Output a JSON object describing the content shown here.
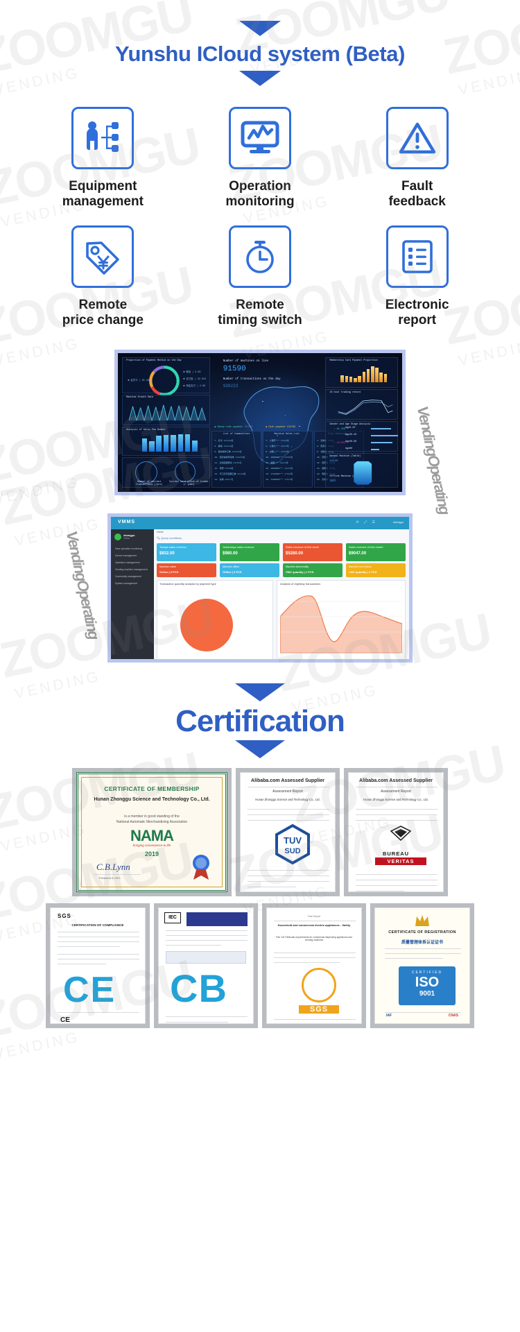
{
  "watermarks": {
    "brand": "ZOOMGU",
    "sub": "VENDING",
    "script": "VendingOperating"
  },
  "hero": {
    "title": "Yunshu ICloud system (Beta)",
    "arrow_color": "#2f5fc4"
  },
  "features": [
    {
      "label_line1": "Equipment",
      "label_line2": "management",
      "icon": "org-chart-person-icon"
    },
    {
      "label_line1": "Operation",
      "label_line2": "monitoring",
      "icon": "monitor-chart-icon"
    },
    {
      "label_line1": "Fault",
      "label_line2": "feedback",
      "icon": "warning-triangle-icon"
    },
    {
      "label_line1": "Remote",
      "label_line2": "price change",
      "icon": "price-tag-yuan-icon"
    },
    {
      "label_line1": "Remote",
      "label_line2": "timing switch",
      "icon": "stopwatch-icon"
    },
    {
      "label_line1": "Electronic",
      "label_line2": "report",
      "icon": "report-list-icon"
    }
  ],
  "dark_dashboard": {
    "panels": {
      "payment_proportion_title": "Proportion of Payment Method on the Day",
      "machines_online_label": "Number of machines on line",
      "machines_online_value": "91590",
      "transactions_label": "Number of transactions on the day",
      "transactions_value": "930223",
      "membership_card_title": "Membership Card Payment Proportion",
      "trading_record_title": "24 hour trading record",
      "machine_growth_title": "Machine Growth Data",
      "sales_pen_title": "Analysis of Sales Pen Number",
      "gender_age_title": "Gender and Age Stage Analysis",
      "commodities_title": "List of Commodities",
      "machine_sales_title": "Machine Sales List",
      "city_rankings_title": "City Rankings",
      "normal_machine_title": "Normal Machine (Table)",
      "offline_machine_title": "Offline Machine (Station)",
      "sweep_code_payment": "Sweep code payment",
      "sweep_code_value": "791333",
      "cash_payment": "Cash payment",
      "cash_value": "132789",
      "gauge_left_label": "Number of current transactions (/pcs)",
      "gauge_right_label": "Current unit price of trader (/ yuan)",
      "normal_value": "61530",
      "offline_value": "4927",
      "age_rows": [
        {
          "label": "Age0-20",
          "pct": "22%"
        },
        {
          "label": "Age20-40",
          "pct": "41%"
        },
        {
          "label": "Age40-60",
          "pct": "24%"
        },
        {
          "label": "Age60",
          "pct": "13%"
        }
      ],
      "gender": [
        {
          "label": "81.25%",
          "color": "#2fd6d0"
        },
        {
          "label": "18.65%",
          "color": "#e8407a"
        }
      ]
    }
  },
  "light_dashboard": {
    "app_name": "VMMS",
    "user": "zhongyu",
    "user_status": "Online",
    "breadcrumb": "Home",
    "query_label": "Query conditions",
    "top_right_user": "zhongyu",
    "sidebar": [
      "Data operation monitoring",
      "Device management",
      "Operation management",
      "Vending machine management",
      "Commodity management",
      "System management"
    ],
    "stat_cards": [
      {
        "title": "Todays sales revenue",
        "value": "$832.00",
        "color": "#3db7e4"
      },
      {
        "title": "Yesterdays sales revenue",
        "value": "$980.00",
        "color": "#31a648"
      },
      {
        "title": "Sales revenue of this week",
        "value": "$5280.00",
        "color": "#ea5532"
      },
      {
        "title": "Sales revenue of this month",
        "value": "$9047.00",
        "color": "#31a648"
      }
    ],
    "status_cards": [
      {
        "title": "Machine online",
        "value": "Online | 3 PCS",
        "color": "#ea5532"
      },
      {
        "title": "Machine offline",
        "value": "Offline | 0 PCS",
        "color": "#3db7e4"
      },
      {
        "title": "Machine abnormality",
        "value": "VMC quantity | 1 PCS",
        "color": "#31a648"
      },
      {
        "title": "Machine out of stock",
        "value": "VMC quantity | 1 PCS",
        "color": "#f2b21a"
      }
    ],
    "chart_left_title": "Transaction quantity analysis by payment type",
    "chart_right_title": "Analysis of eightday transactions"
  },
  "certification": {
    "title": "Certification"
  },
  "certificates_row1": [
    {
      "name": "nama-membership",
      "title": "CERTIFICATE OF MEMBERSHIP",
      "company": "Hunan Zhonggu Science and Technology Co., Ltd.",
      "line1": "is a member in good standing of the",
      "line2": "National Automatic Merchandising Association",
      "logo": "NAMA",
      "tagline": "bringing convenience to life",
      "year": "2019",
      "signature": "President & CEO"
    },
    {
      "name": "alibaba-tuv",
      "header": "Alibaba.com Assessed Supplier",
      "subheader": "Assessment Report",
      "company": "Hunan Zhonggu Science and Technology Co., Ltd.",
      "badge_top": "TUV",
      "badge_bottom": "SUD"
    },
    {
      "name": "alibaba-bureau-veritas",
      "header": "Alibaba.com Assessed Supplier",
      "subheader": "Assessment Report",
      "company": "Hunan Zhonggu Science and Technology Co., Ltd.",
      "badge_top": "BUREAU",
      "badge_bottom": "VERITAS"
    }
  ],
  "certificates_row2": [
    {
      "name": "sgs-ce",
      "header": "SGS",
      "title": "CERTIFICATION OF COMPLIANCE",
      "mark": "CE",
      "footer": "CE"
    },
    {
      "name": "cb-certificate",
      "header": "IEC",
      "mark": "CB"
    },
    {
      "name": "sgs-machinery",
      "title": "Household and commercial electric appliances - Safety",
      "subtitle": "Part 1/5: Particular requirements for commercial dispensing appliances and vending machines",
      "mark": "SGS"
    },
    {
      "name": "iso-registration",
      "title": "CERTIFICATE OF REGISTRATION",
      "chinese": "质量管理体系认证证书",
      "mark": "ISO",
      "mark_sub": "9001"
    }
  ]
}
